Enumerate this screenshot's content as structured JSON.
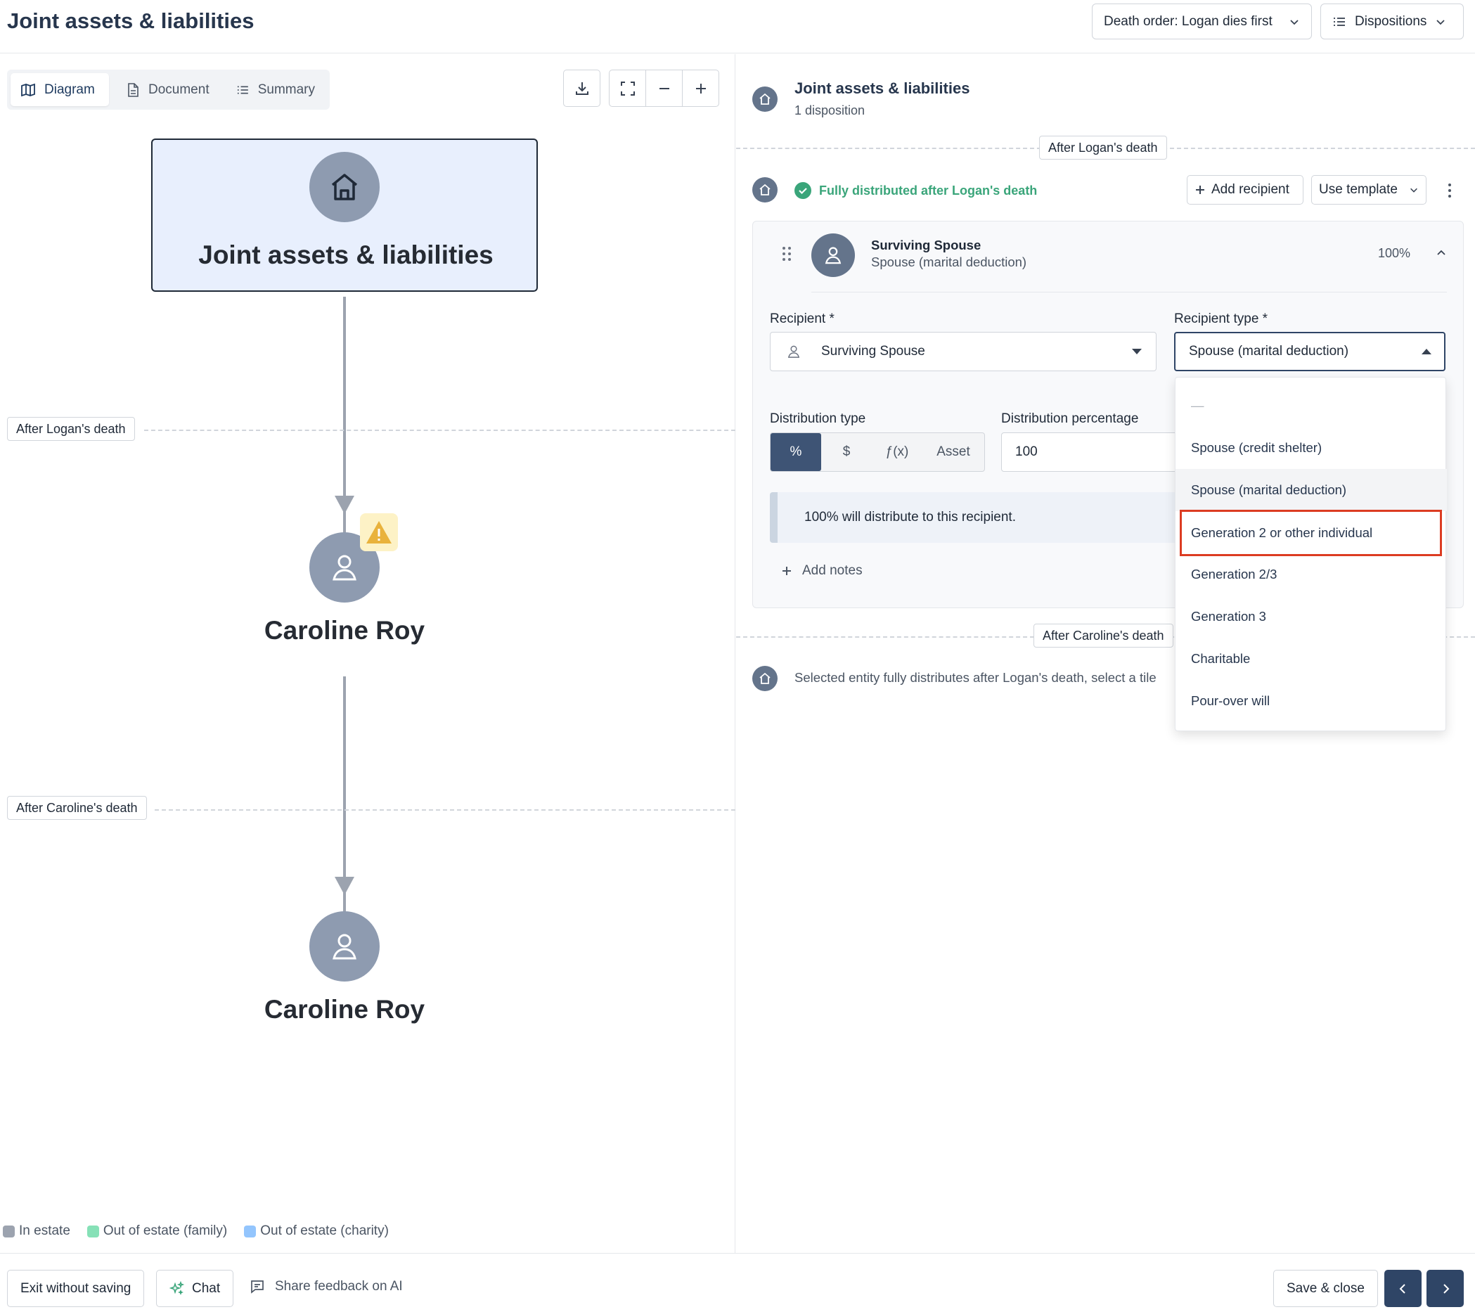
{
  "header": {
    "title": "Joint assets & liabilities",
    "death_order": "Death order: Logan dies first",
    "dispositions": "Dispositions"
  },
  "view_tabs": [
    {
      "label": "Diagram",
      "icon": "map-icon"
    },
    {
      "label": "Document",
      "icon": "document-icon"
    },
    {
      "label": "Summary",
      "icon": "list-icon"
    }
  ],
  "diagram": {
    "root": "Joint assets & liabilities",
    "after_logan_label": "After Logan's death",
    "after_caroline_label": "After Caroline's death",
    "node_1": "Caroline Roy",
    "node_2": "Caroline Roy"
  },
  "legend": [
    {
      "label": "In estate",
      "color": "#9ca3af"
    },
    {
      "label": "Out of estate (family)",
      "color": "#86e1b7"
    },
    {
      "label": "Out of estate (charity)",
      "color": "#93c5fd"
    }
  ],
  "panel": {
    "title": "Joint assets & liabilities",
    "subtitle": "1 disposition",
    "after_logan_label": "After Logan's death",
    "status": "Fully distributed after Logan's death",
    "add_recipient": "Add recipient",
    "use_template": "Use template",
    "recipient_card": {
      "name": "Surviving Spouse",
      "type": "Spouse (marital deduction)",
      "percent": "100%",
      "recipient_label": "Recipient *",
      "recipient_value": "Surviving Spouse",
      "recipient_type_label": "Recipient type *",
      "recipient_type_value": "Spouse (marital deduction)",
      "distribution_type_label": "Distribution type",
      "distribution_types": [
        "%",
        "$",
        "ƒ(x)",
        "Asset"
      ],
      "distribution_pct_label": "Distribution percentage",
      "distribution_pct_value": "100",
      "info": "100% will distribute to this recipient.",
      "add_notes": "Add notes"
    },
    "after_caroline_label": "After Caroline's death",
    "caroline_note": "Selected entity fully distributes after Logan's death, select a tile"
  },
  "recipient_type_options": [
    "—",
    "Spouse (credit shelter)",
    "Spouse (marital deduction)",
    "Generation 2 or other individual",
    "Generation 2/3",
    "Generation 3",
    "Charitable",
    "Pour-over will"
  ],
  "footer": {
    "exit": "Exit without saving",
    "chat": "Chat",
    "feedback": "Share feedback on AI",
    "save": "Save & close"
  }
}
